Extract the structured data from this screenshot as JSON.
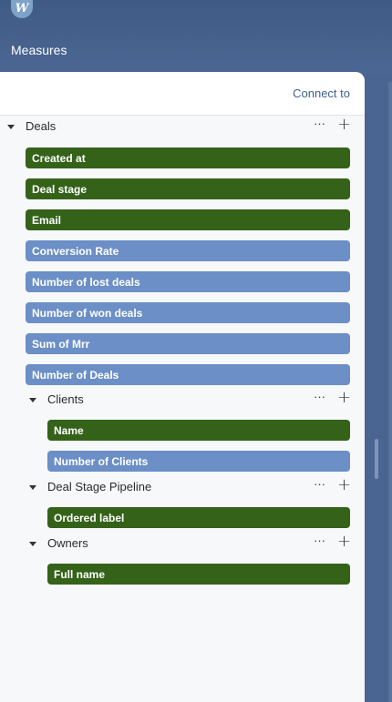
{
  "header": {
    "title": "Measures",
    "logo_text": "W"
  },
  "panel": {
    "connect_label": "Connect to"
  },
  "colors": {
    "dimension": "#346219",
    "measure": "#6b8fc6",
    "accent": "#3d5f8f"
  },
  "groups": [
    {
      "label": "Deals",
      "items": [
        {
          "label": "Created at",
          "kind": "dimension"
        },
        {
          "label": "Deal stage",
          "kind": "dimension"
        },
        {
          "label": "Email",
          "kind": "dimension"
        },
        {
          "label": "Conversion Rate",
          "kind": "measure"
        },
        {
          "label": "Number of lost deals",
          "kind": "measure"
        },
        {
          "label": "Number of won deals",
          "kind": "measure"
        },
        {
          "label": "Sum of Mrr",
          "kind": "measure"
        },
        {
          "label": "Number of Deals",
          "kind": "measure"
        }
      ]
    },
    {
      "label": "Clients",
      "items": [
        {
          "label": "Name",
          "kind": "dimension"
        },
        {
          "label": "Number of Clients",
          "kind": "measure"
        }
      ]
    },
    {
      "label": "Deal Stage Pipeline",
      "items": [
        {
          "label": "Ordered label",
          "kind": "dimension"
        }
      ]
    },
    {
      "label": "Owners",
      "items": [
        {
          "label": "Full name",
          "kind": "dimension"
        }
      ]
    }
  ],
  "icons": {
    "more": "ellipsis-icon",
    "add": "plus-icon",
    "expand": "caret-down-icon"
  }
}
